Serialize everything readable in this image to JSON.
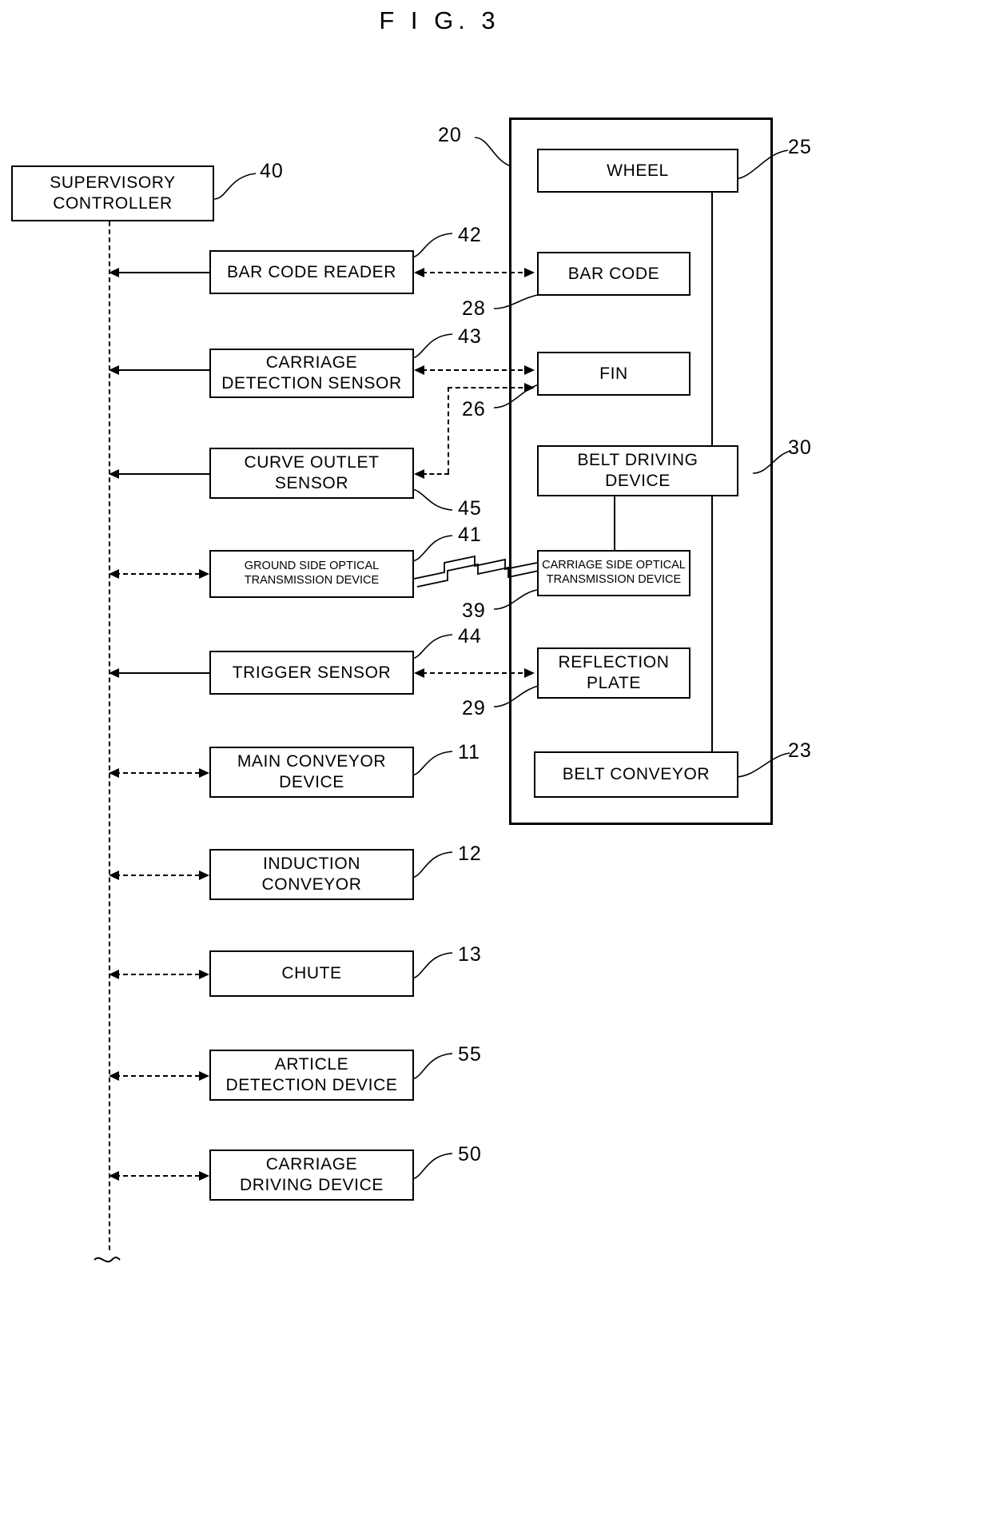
{
  "figure": {
    "title": "F I G.  3",
    "type": "patent-block-diagram"
  },
  "left_column": {
    "controller": {
      "line1": "SUPERVISORY",
      "line2": "CONTROLLER",
      "ref": "40"
    },
    "blocks": [
      {
        "name": "bar-code-reader",
        "line1": "BAR CODE READER",
        "line2": "",
        "ref": "42"
      },
      {
        "name": "carriage-detection-sensor",
        "line1": "CARRIAGE",
        "line2": "DETECTION SENSOR",
        "ref": "43"
      },
      {
        "name": "curve-outlet-sensor",
        "line1": "CURVE OUTLET",
        "line2": "SENSOR",
        "ref": "45"
      },
      {
        "name": "ground-side-optical-transmission-device",
        "line1": "GROUND SIDE OPTICAL",
        "line2": "TRANSMISSION DEVICE",
        "ref": "41"
      },
      {
        "name": "trigger-sensor",
        "line1": "TRIGGER SENSOR",
        "line2": "",
        "ref": "44"
      },
      {
        "name": "main-conveyor-device",
        "line1": "MAIN CONVEYOR",
        "line2": "DEVICE",
        "ref": "11"
      },
      {
        "name": "induction-conveyor",
        "line1": "INDUCTION",
        "line2": "CONVEYOR",
        "ref": "12"
      },
      {
        "name": "chute",
        "line1": "CHUTE",
        "line2": "",
        "ref": "13"
      },
      {
        "name": "article-detection-device",
        "line1": "ARTICLE",
        "line2": "DETECTION DEVICE",
        "ref": "55"
      },
      {
        "name": "carriage-driving-device",
        "line1": "CARRIAGE",
        "line2": "DRIVING DEVICE",
        "ref": "50"
      }
    ]
  },
  "carriage_container": {
    "ref": "20",
    "blocks": [
      {
        "name": "wheel",
        "line1": "WHEEL",
        "line2": "",
        "ref": "25"
      },
      {
        "name": "bar-code",
        "line1": "BAR CODE",
        "line2": "",
        "ref": "28"
      },
      {
        "name": "fin",
        "line1": "FIN",
        "line2": "",
        "ref": "26"
      },
      {
        "name": "belt-driving-device",
        "line1": "BELT DRIVING",
        "line2": "DEVICE",
        "ref": "30"
      },
      {
        "name": "carriage-side-optical-transmission-device",
        "line1": "CARRIAGE SIDE OPTICAL",
        "line2": "TRANSMISSION DEVICE",
        "ref": "39"
      },
      {
        "name": "reflection-plate",
        "line1": "REFLECTION",
        "line2": "PLATE",
        "ref": "29"
      },
      {
        "name": "belt-conveyor",
        "line1": "BELT CONVEYOR",
        "line2": "",
        "ref": "23"
      }
    ]
  },
  "colors": {
    "ink": "#000000",
    "paper": "#ffffff"
  }
}
